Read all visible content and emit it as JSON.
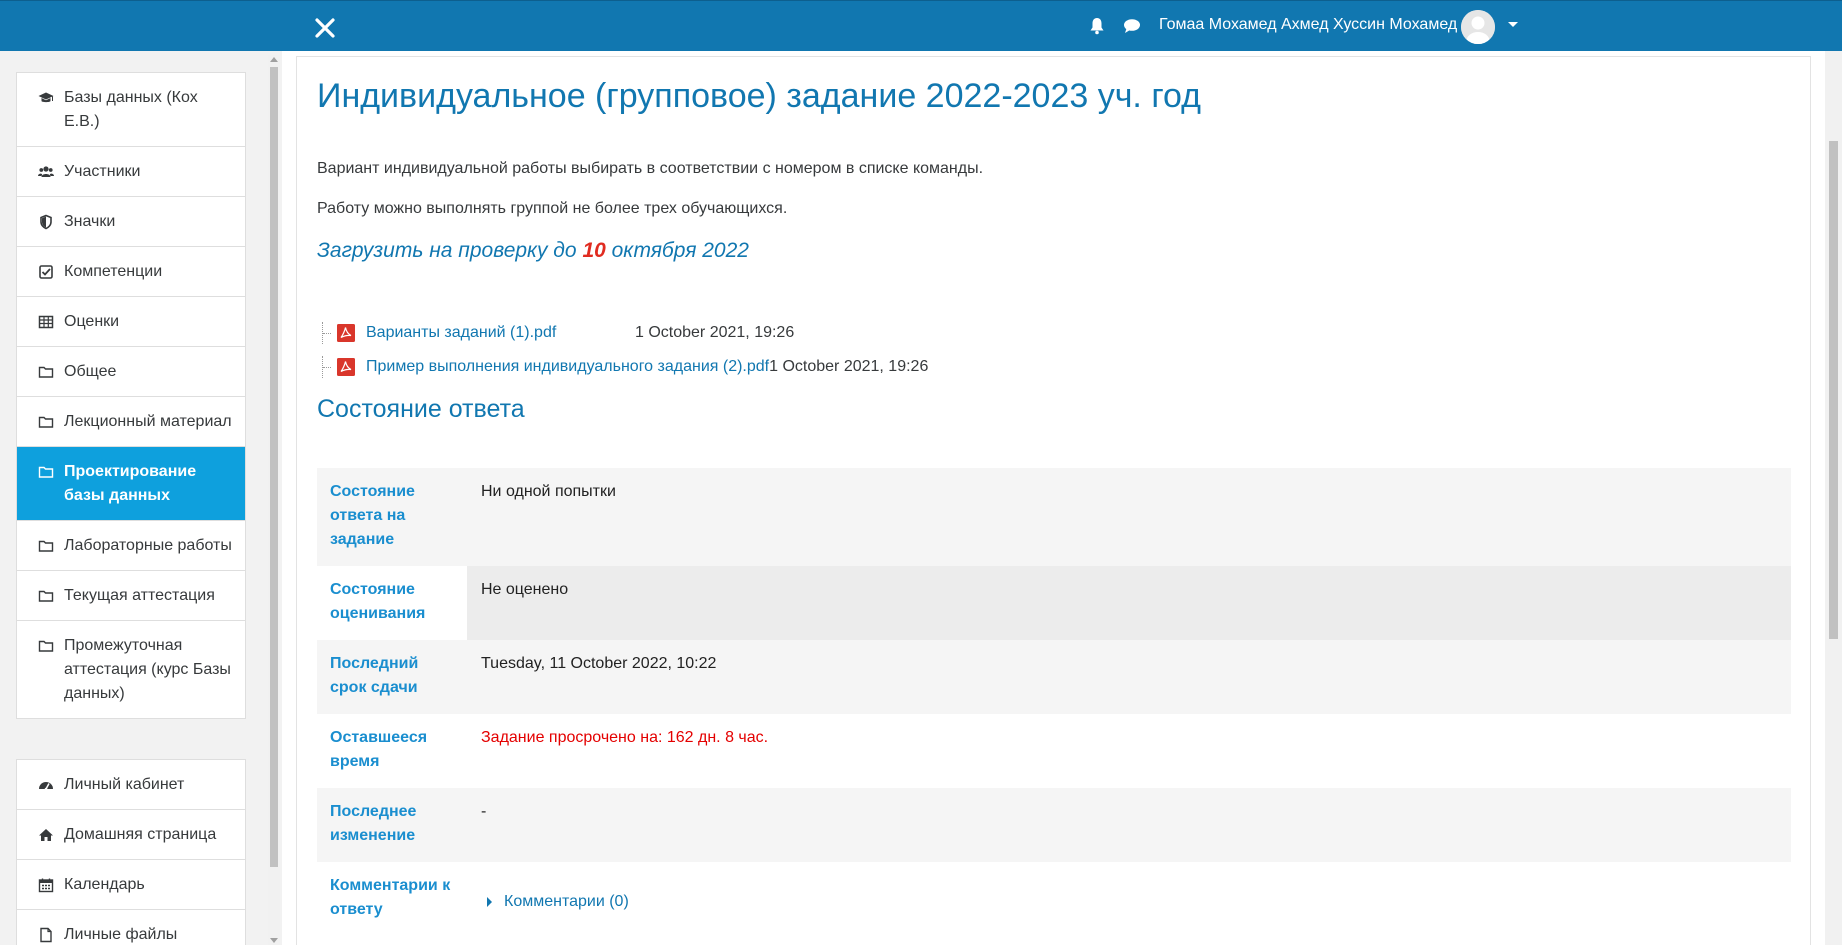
{
  "navbar": {
    "close_icon": "close-icon",
    "notifications_icon": "bell-icon",
    "messages_icon": "chat-icon",
    "user_name": "Гомаа Мохамед Ахмед Хуссин Мохамед",
    "avatar_icon": "user-avatar-icon",
    "menu_icon": "caret-down-icon",
    "color": "#1177b0"
  },
  "sidebar": {
    "course_items": [
      {
        "label": "Базы данных (Кох Е.В.)",
        "icon": "graduation-cap-icon"
      },
      {
        "label": "Участники",
        "icon": "users-icon"
      },
      {
        "label": "Значки",
        "icon": "shield-icon"
      },
      {
        "label": "Компетенции",
        "icon": "checkbox-icon"
      },
      {
        "label": "Оценки",
        "icon": "table-icon"
      },
      {
        "label": "Общее",
        "icon": "folder-icon"
      },
      {
        "label": "Лекционный материал",
        "icon": "folder-icon"
      },
      {
        "label": "Проектирование базы данных",
        "icon": "folder-icon",
        "active": true
      },
      {
        "label": "Лабораторные работы",
        "icon": "folder-icon"
      },
      {
        "label": "Текущая аттестация",
        "icon": "folder-icon"
      },
      {
        "label": "Промежуточная аттестация (курс Базы данных)",
        "icon": "folder-icon"
      }
    ],
    "site_items": [
      {
        "label": "Личный кабинет",
        "icon": "dashboard-icon"
      },
      {
        "label": "Домашняя страница",
        "icon": "home-icon"
      },
      {
        "label": "Календарь",
        "icon": "calendar-icon"
      },
      {
        "label": "Личные файлы",
        "icon": "file-icon"
      }
    ],
    "active_color": "#0ea0dd"
  },
  "main": {
    "title": "Индивидуальное (групповое) задание 2022-2023 уч. год",
    "intro_line1": "Вариант индивидуальной работы выбирать в соответствии с номером в списке команды.",
    "intro_line2": "Работу можно выполнять группой не более трех обучающихся.",
    "deadline": {
      "prefix": "Загрузить на проверку до ",
      "day": "10",
      "suffix": "  октября 2022"
    },
    "files": [
      {
        "name": "Варианты заданий (1).pdf",
        "date": "1 October 2021, 19:26",
        "icon": "pdf-icon"
      },
      {
        "name": "Пример выполнения индивидуального задания (2).pdf",
        "date": "1 October 2021, 19:26",
        "icon": "pdf-icon"
      }
    ],
    "status_heading": "Состояние ответа",
    "status_rows": [
      {
        "label": "Состояние ответа на задание",
        "value": "Ни одной попытки"
      },
      {
        "label": "Состояние оценивания",
        "value": "Не оценено"
      },
      {
        "label": "Последний срок сдачи",
        "value": "Tuesday, 11 October 2022, 10:22"
      },
      {
        "label": "Оставшееся время",
        "value": "Задание просрочено на: 162 дн. 8 час."
      },
      {
        "label": "Последнее изменение",
        "value": "-"
      },
      {
        "label": "Комментарии к ответу",
        "value": "Комментарии (0)"
      }
    ]
  }
}
